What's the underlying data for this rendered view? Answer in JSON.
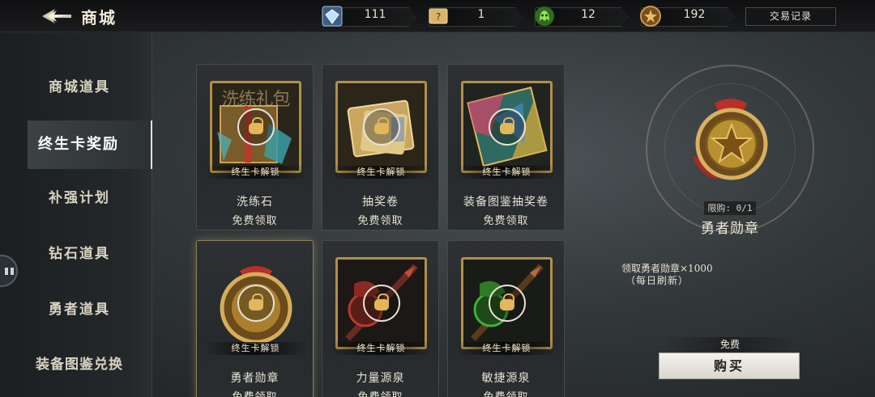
{
  "header": {
    "title": "商城",
    "resources": [
      {
        "icon": "diamond-icon",
        "value": "111"
      },
      {
        "icon": "ticket-icon",
        "value": "1"
      },
      {
        "icon": "green-spirit-icon",
        "value": "12"
      },
      {
        "icon": "medal-coin-icon",
        "value": "192"
      }
    ],
    "trade_record_label": "交易记录"
  },
  "sidebar": {
    "items": [
      {
        "label": "商城道具"
      },
      {
        "label": "终生卡奖励",
        "active": true
      },
      {
        "label": "补强计划"
      },
      {
        "label": "钻石道具"
      },
      {
        "label": "勇者道具"
      },
      {
        "label": "装备图鉴兑换"
      }
    ]
  },
  "cards": [
    {
      "name": "洗练石",
      "sub": "免费领取",
      "lock_text": "终生卡解锁",
      "watermark": "洗练礼包",
      "icon": "refine-stone-box-icon"
    },
    {
      "name": "抽奖卷",
      "sub": "免费领取",
      "lock_text": "终生卡解锁",
      "icon": "lottery-ticket-icon"
    },
    {
      "name": "装备图鉴抽奖卷",
      "sub": "免费领取",
      "lock_text": "终生卡解锁",
      "icon": "equipment-card-icon"
    },
    {
      "name": "勇者勋章",
      "sub": "免费领取",
      "lock_text": "终生卡解锁",
      "icon": "hero-medal-icon",
      "selected": true
    },
    {
      "name": "力量源泉",
      "sub": "免费领取",
      "lock_text": "终生卡解锁",
      "icon": "red-weapon-icon"
    },
    {
      "name": "敏捷源泉",
      "sub": "免费领取",
      "lock_text": "终生卡解锁",
      "icon": "green-weapon-icon"
    }
  ],
  "detail": {
    "limit": "限购: 0/1",
    "name": "勇者勋章",
    "desc_line1": "领取勇者勋章×1000",
    "desc_line2": "（每日刷新）",
    "price": "免费",
    "buy_label": "购买",
    "icon": "hero-medal-icon"
  },
  "colors": {
    "accent_gold": "#b28f48",
    "lock_gold": "#e3b65a",
    "button_bg": "#f4f2ec"
  }
}
